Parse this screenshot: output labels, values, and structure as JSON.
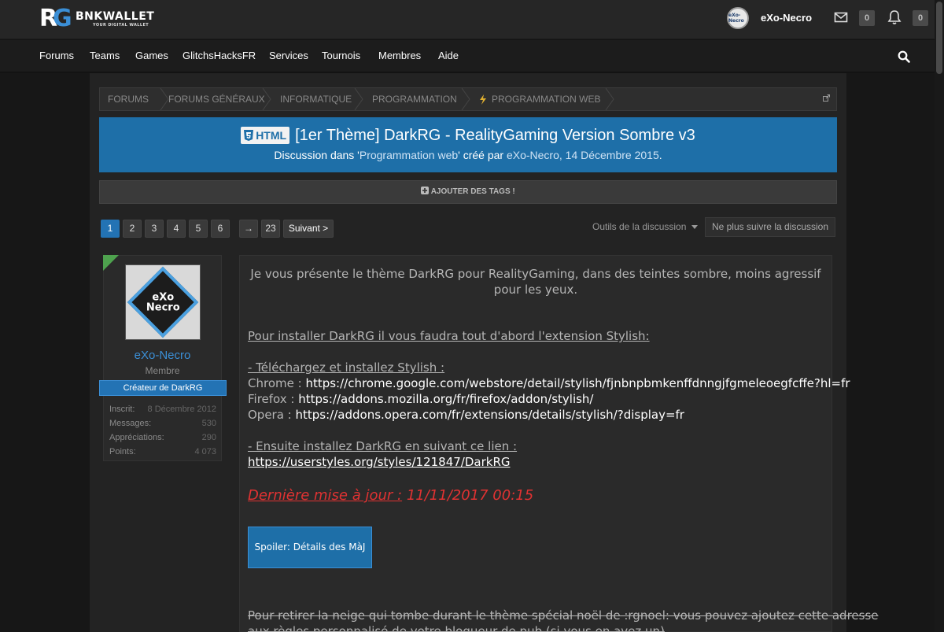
{
  "header": {
    "logo_title": "BNKWALLET",
    "logo_subtitle": "YOUR DIGITAL WALLET",
    "avatar_text": "eXo-Necro",
    "username": "eXo-Necro",
    "messages_count": "0",
    "alerts_count": "0"
  },
  "nav": {
    "items": [
      "Forums",
      "Teams",
      "Games",
      "GlitchsHacksFR",
      "Services",
      "Tournois",
      "Membres",
      "Aide"
    ]
  },
  "breadcrumb": [
    "FORUMS",
    "FORUMS GÉNÉRAUX",
    "INFORMATIQUE",
    "PROGRAMMATION",
    "PROGRAMMATION WEB"
  ],
  "thread": {
    "prefix": "HTML",
    "title": "[1er Thème] DarkRG - RealityGaming Version Sombre v3",
    "meta_before": "Discussion dans '",
    "meta_forum": "Programmation web",
    "meta_middle": "' créé par ",
    "meta_author": "eXo-Necro",
    "meta_date": ", 14 Décembre 2015",
    "meta_end": "."
  },
  "tags_label": "AJOUTER DES TAGS !",
  "pagination": {
    "pages": [
      "1",
      "2",
      "3",
      "4",
      "5",
      "6"
    ],
    "arrow": "→",
    "last": "23",
    "next": "Suivant >",
    "current": 1
  },
  "tools_label": "Outils de la discussion",
  "unfollow_label": "Ne plus suivre la discussion",
  "author": {
    "avatar_text_1": "eXo",
    "avatar_text_2": "Necro",
    "name": "eXo-Necro",
    "role": "Membre",
    "badge": "Créateur de DarkRG",
    "stats": [
      {
        "label": "Inscrit:",
        "value": "8 Décembre 2012"
      },
      {
        "label": "Messages:",
        "value": "530"
      },
      {
        "label": "Appréciations:",
        "value": "290"
      },
      {
        "label": "Points:",
        "value": "4 073"
      }
    ]
  },
  "post": {
    "intro": "Je vous présente le thème DarkRG pour RealityGaming, dans des teintes sombre, moins agressif pour les yeux.",
    "install_heading": "Pour installer DarkRG il vous faudra tout d'abord l'extension Stylish:",
    "step1_heading": "- Téléchargez et installez Stylish :",
    "chrome_label": "Chrome : ",
    "chrome_url": "https://chrome.google.com/webstore/detail/stylish/fjnbnpbmkenffdnngjfgmeleoegfcffe?hl=fr",
    "firefox_label": "Firefox : ",
    "firefox_url": "https://addons.mozilla.org/fr/firefox/addon/stylish/",
    "opera_label": "Opera : ",
    "opera_url": "https://addons.opera.com/fr/extensions/details/stylish/?display=fr",
    "step2_heading": "- Ensuite installez DarkRG en suivant ce lien :",
    "darkrg_url": "https://userstyles.org/styles/121847/DarkRG",
    "update_label": "Dernière mise à jour :",
    "update_value": " 11/11/2017 00:15",
    "spoiler": "Spoiler: Détails des MàJ",
    "snow_line1": "Pour retirer la neige qui tombe durant le thème spécial noël de :rgnoel: vous pouvez ajoutez cette adresse",
    "snow_line2": "aux règles personnalisé de votre bloqueur de pub (si vous en avez un)"
  },
  "colors": {
    "accent": "#1e6fa8",
    "link": "#3b8fd6",
    "update_red": "#e03232",
    "online_flag": "#4ea24e"
  }
}
